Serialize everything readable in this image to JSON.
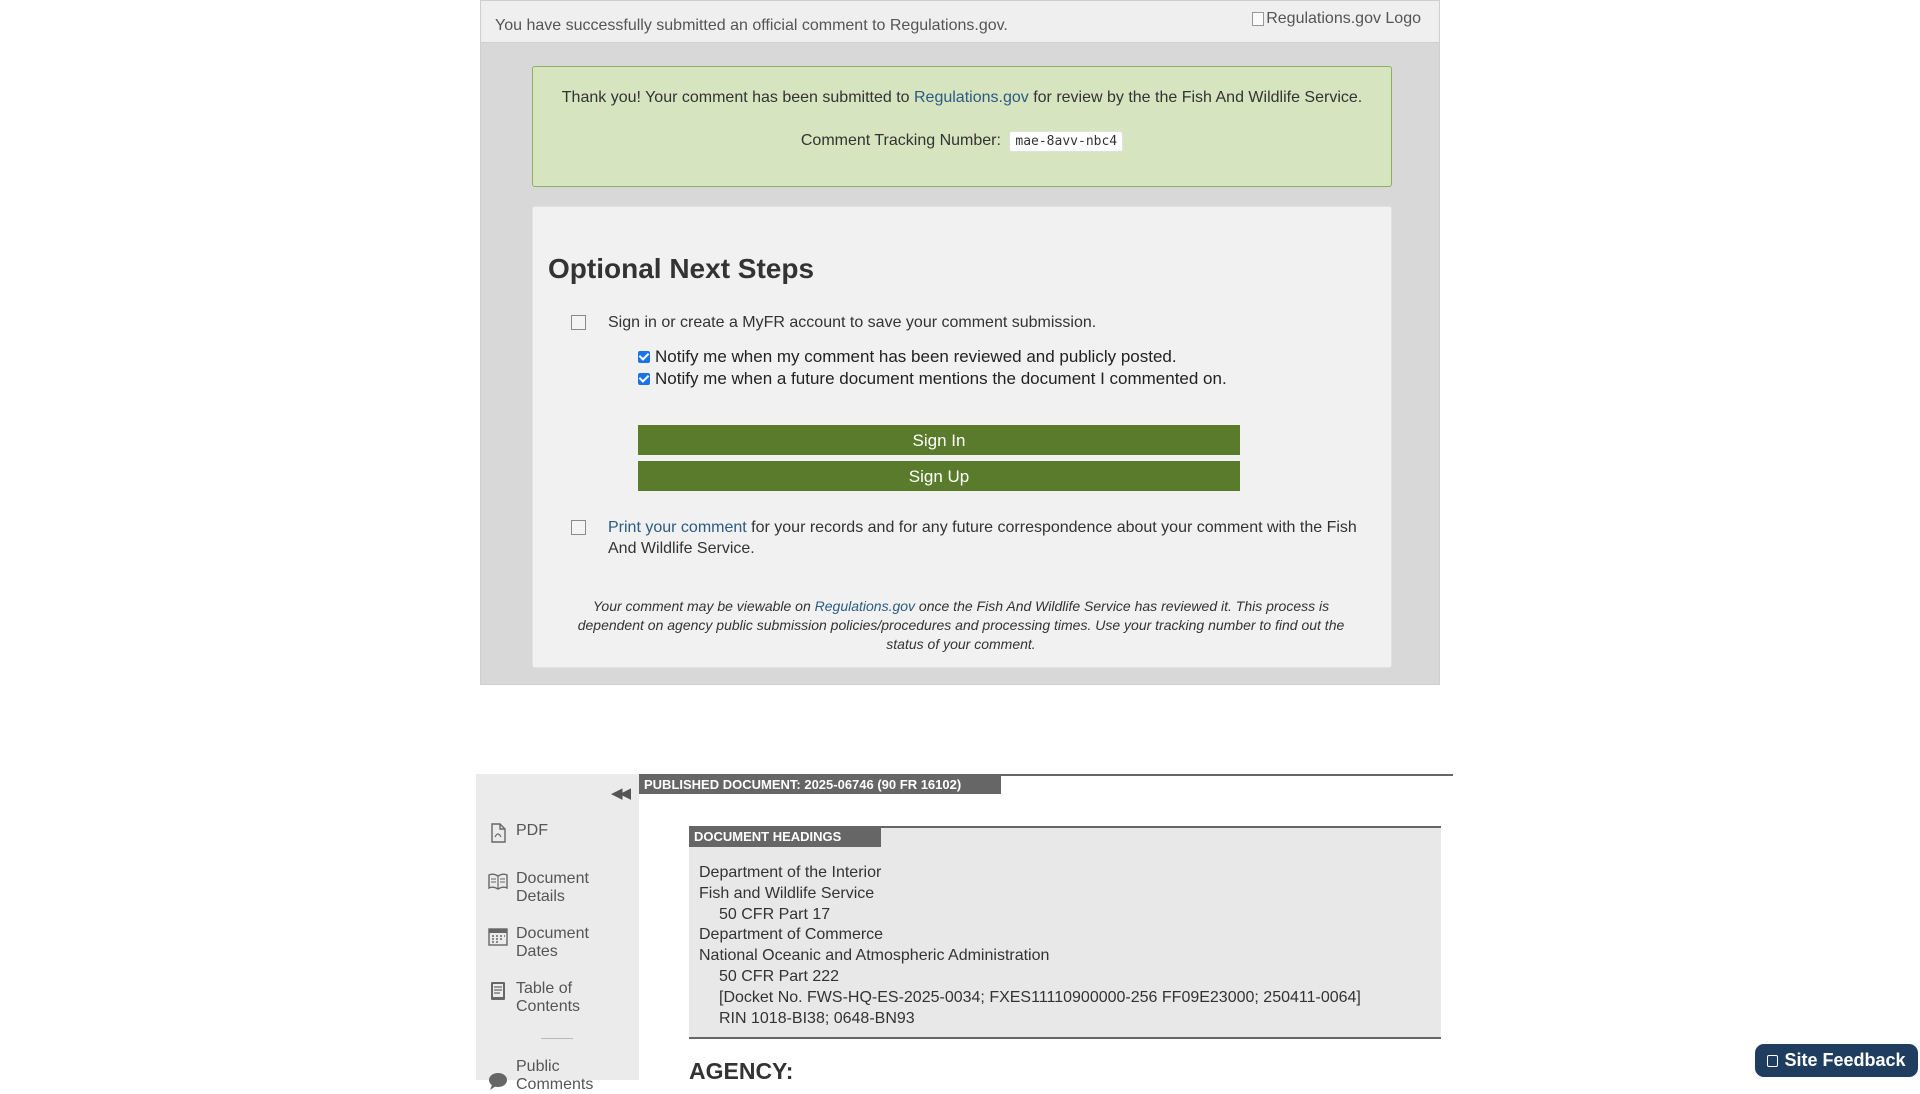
{
  "modal": {
    "header_message": "You have successfully submitted an official comment to Regulations.gov.",
    "logo_alt": "Regulations.gov Logo",
    "success": {
      "thanks_prefix": "Thank you! Your comment has been submitted to ",
      "thanks_link": "Regulations.gov",
      "thanks_suffix": " for review by the the Fish And Wildlife Service.",
      "tracking_label": "Comment Tracking Number:",
      "tracking_number": "mae-8avv-nbc4"
    },
    "next_steps": {
      "title": "Optional Next Steps",
      "step1": "Sign in or create a MyFR account to save your comment submission.",
      "notify_reviewed": "Notify me when my comment has been reviewed and publicly posted.",
      "notify_future": "Notify me when a future document mentions the document I commented on.",
      "sign_in": "Sign In",
      "sign_up": "Sign Up",
      "print_link": "Print your comment",
      "print_text": " for your records and for any future correspondence about your comment with the Fish And Wildlife Service.",
      "note_prefix": "Your comment may be viewable on ",
      "note_link": "Regulations.gov",
      "note_suffix": " once the Fish And Wildlife Service has reviewed it. This process is dependent on agency public submission policies/procedures and processing times. Use your tracking number to find out the status of your comment."
    }
  },
  "document": {
    "published_label": "PUBLISHED DOCUMENT: 2025-06746 (90 FR 16102)",
    "sidebar": [
      {
        "label": "PDF",
        "icon": "pdf-icon"
      },
      {
        "label": "Document Details",
        "icon": "book-icon"
      },
      {
        "label": "Document Dates",
        "icon": "calendar-icon"
      },
      {
        "label": "Table of Contents",
        "icon": "table-of-contents-icon"
      },
      {
        "label": "Public Comments",
        "icon": "comment-icon"
      }
    ],
    "headings_label": "DOCUMENT HEADINGS",
    "headings": [
      "Department of the Interior",
      "Fish and Wildlife Service",
      "50 CFR Part 17",
      "Department of Commerce",
      "National Oceanic and Atmospheric Administration",
      "50 CFR Part 222",
      "[Docket No. FWS-HQ-ES-2025-0034; FXES11110900000-256 FF09E23000; 250411-0064]",
      "RIN 1018-BI38; 0648-BN93"
    ],
    "agency_heading": "AGENCY:"
  },
  "feedback_button": "Site Feedback",
  "colors": {
    "success_bg": "#d6e4bf",
    "button_green": "#5b7b2c",
    "link_blue": "#2b5b84",
    "feedback_bg": "#1f3d5f"
  }
}
